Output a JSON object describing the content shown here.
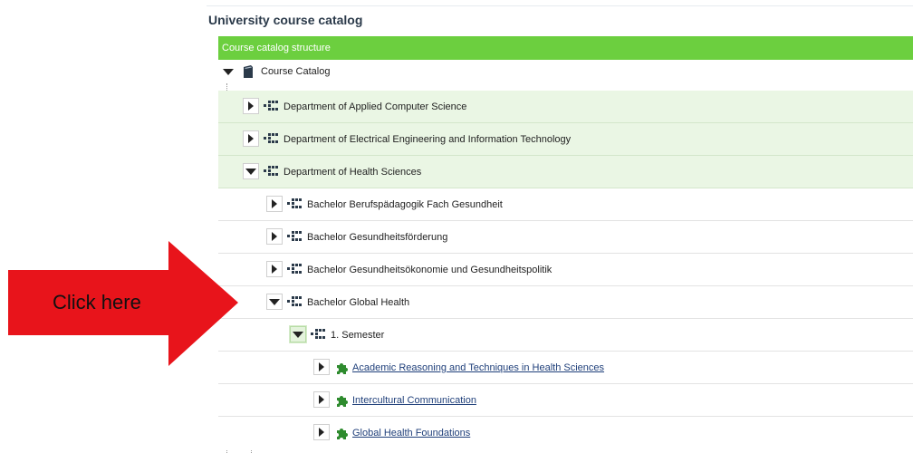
{
  "page": {
    "title": "University course catalog"
  },
  "panel": {
    "header": "Course catalog structure"
  },
  "tree": {
    "root": {
      "label": "Course Catalog"
    },
    "departments": [
      {
        "label": "Department of Applied Computer Science"
      },
      {
        "label": "Department of Electrical Engineering and Information Technology"
      },
      {
        "label": "Department of Health Sciences"
      }
    ],
    "programs": [
      {
        "label": "Bachelor Berufspädagogik Fach Gesundheit"
      },
      {
        "label": "Bachelor Gesundheitsförderung"
      },
      {
        "label": "Bachelor Gesundheitsökonomie und Gesundheitspolitik"
      },
      {
        "label": "Bachelor Global Health"
      }
    ],
    "semester": {
      "label": "1. Semester"
    },
    "modules": [
      {
        "label": "Academic Reasoning and Techniques in Health Sciences"
      },
      {
        "label": "Intercultural Communication"
      },
      {
        "label": "Global Health Foundations"
      }
    ]
  },
  "annotation": {
    "text": "Click here",
    "color": "#e8141b"
  },
  "colors": {
    "header_bg": "#6ccf3f",
    "row_highlight": "#eaf6e4",
    "module_icon": "#2e8b2e"
  }
}
